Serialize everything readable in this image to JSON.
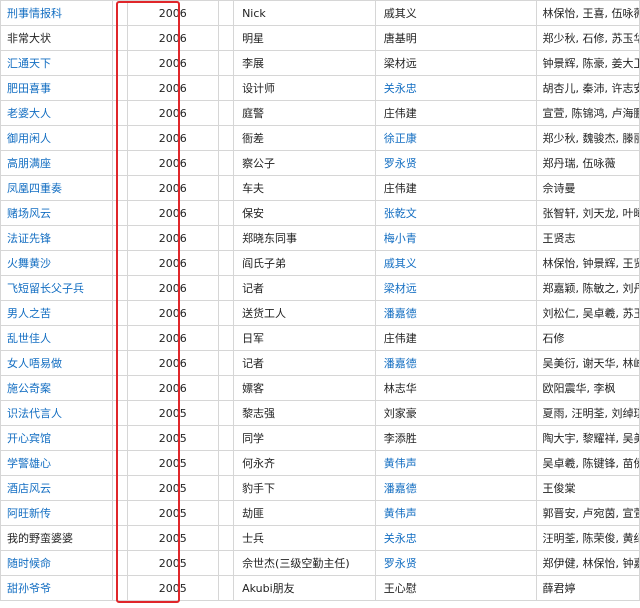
{
  "rows": [
    {
      "title": "刑事情报科",
      "title_link": true,
      "year": "2006",
      "role": "Nick",
      "director": "戚其义",
      "director_link": false,
      "cast": "林保怡, 王喜, 伍咏薇"
    },
    {
      "title": "非常大状",
      "title_link": false,
      "year": "2006",
      "role": "明星",
      "director": "唐基明",
      "director_link": false,
      "cast": "郑少秋, 石修, 苏玉华"
    },
    {
      "title": "汇通天下",
      "title_link": true,
      "year": "2006",
      "role": "李展",
      "director": "梁材远",
      "director_link": false,
      "cast": "钟景辉, 陈豪, 姜大卫"
    },
    {
      "title": "肥田喜事",
      "title_link": true,
      "year": "2006",
      "role": "设计师",
      "director": "关永忠",
      "director_link": true,
      "cast": "胡杏儿, 秦沛, 许志安"
    },
    {
      "title": "老婆大人",
      "title_link": true,
      "year": "2006",
      "role": "庭警",
      "director": "庄伟建",
      "director_link": false,
      "cast": "宣萱, 陈锦鸿, 卢海鹏"
    },
    {
      "title": "御用闲人",
      "title_link": true,
      "year": "2006",
      "role": "衙差",
      "director": "徐正康",
      "director_link": true,
      "cast": "郑少秋, 魏骏杰, 滕丽名"
    },
    {
      "title": "高朋满座",
      "title_link": true,
      "year": "2006",
      "role": "察公子",
      "director": "罗永贤",
      "director_link": true,
      "cast": "郑丹瑞, 伍咏薇"
    },
    {
      "title": "凤凰四重奏",
      "title_link": true,
      "year": "2006",
      "role": "车夫",
      "director": "庄伟建",
      "director_link": false,
      "cast": "佘诗曼"
    },
    {
      "title": "赌场风云",
      "title_link": true,
      "year": "2006",
      "role": "保安",
      "director": "张乾文",
      "director_link": true,
      "cast": "张智轩, 刘天龙, 叶暐"
    },
    {
      "title": "法证先锋",
      "title_link": true,
      "year": "2006",
      "role": "郑晓东同事",
      "director": "梅小青",
      "director_link": true,
      "cast": "王贤志"
    },
    {
      "title": "火舞黄沙",
      "title_link": true,
      "year": "2006",
      "role": "阎氏子弟",
      "director": "戚其义",
      "director_link": true,
      "cast": "林保怡, 钟景辉, 王贤志"
    },
    {
      "title": "飞短留长父子兵",
      "title_link": true,
      "year": "2006",
      "role": "记者",
      "director": "梁材远",
      "director_link": true,
      "cast": "郑嘉颖, 陈敏之, 刘丹"
    },
    {
      "title": "男人之苦",
      "title_link": true,
      "year": "2006",
      "role": "送货工人",
      "director": "潘嘉德",
      "director_link": true,
      "cast": "刘松仁, 吴卓羲, 苏玉华"
    },
    {
      "title": "乱世佳人",
      "title_link": true,
      "year": "2006",
      "role": "日军",
      "director": "庄伟建",
      "director_link": false,
      "cast": "石修"
    },
    {
      "title": "女人唔易做",
      "title_link": true,
      "year": "2006",
      "role": "记者",
      "director": "潘嘉德",
      "director_link": true,
      "cast": "吴美衍, 谢天华, 林峰"
    },
    {
      "title": "施公奇案",
      "title_link": true,
      "year": "2006",
      "role": "嫖客",
      "director": "林志华",
      "director_link": false,
      "cast": "欧阳震华, 李枫"
    },
    {
      "title": "识法代言人",
      "title_link": true,
      "year": "2005",
      "role": "黎志强",
      "director": "刘家豪",
      "director_link": false,
      "cast": "夏雨, 汪明荃, 刘绰琪"
    },
    {
      "title": "开心宾馆",
      "title_link": true,
      "year": "2005",
      "role": "同学",
      "director": "李添胜",
      "director_link": false,
      "cast": "陶大宇, 黎耀祥, 吴美衍"
    },
    {
      "title": "学警雄心",
      "title_link": true,
      "year": "2005",
      "role": "何永齐",
      "director": "黄伟声",
      "director_link": true,
      "cast": "吴卓羲, 陈键锋, 苗侨伟"
    },
    {
      "title": "酒店风云",
      "title_link": true,
      "year": "2005",
      "role": "豹手下",
      "director": "潘嘉德",
      "director_link": true,
      "cast": "王俊棠"
    },
    {
      "title": "阿旺新传",
      "title_link": true,
      "year": "2005",
      "role": "劫匪",
      "director": "黄伟声",
      "director_link": true,
      "cast": "郭晋安, 卢宛茵, 宣萱"
    },
    {
      "title": "我的野蛮婆婆",
      "title_link": false,
      "year": "2005",
      "role": "士兵",
      "director": "关永忠",
      "director_link": true,
      "cast": "汪明荃, 陈荣俊, 黄纪莹"
    },
    {
      "title": "随时候命",
      "title_link": true,
      "year": "2005",
      "role": "佘世杰(三级空勤主任)",
      "director": "罗永贤",
      "director_link": true,
      "cast": "郑伊健, 林保怡, 钟嘉欣"
    },
    {
      "title": "甜孙爷爷",
      "title_link": true,
      "year": "2005",
      "role": "Akubi朋友",
      "director": "王心慰",
      "director_link": false,
      "cast": "薛君婷"
    }
  ]
}
